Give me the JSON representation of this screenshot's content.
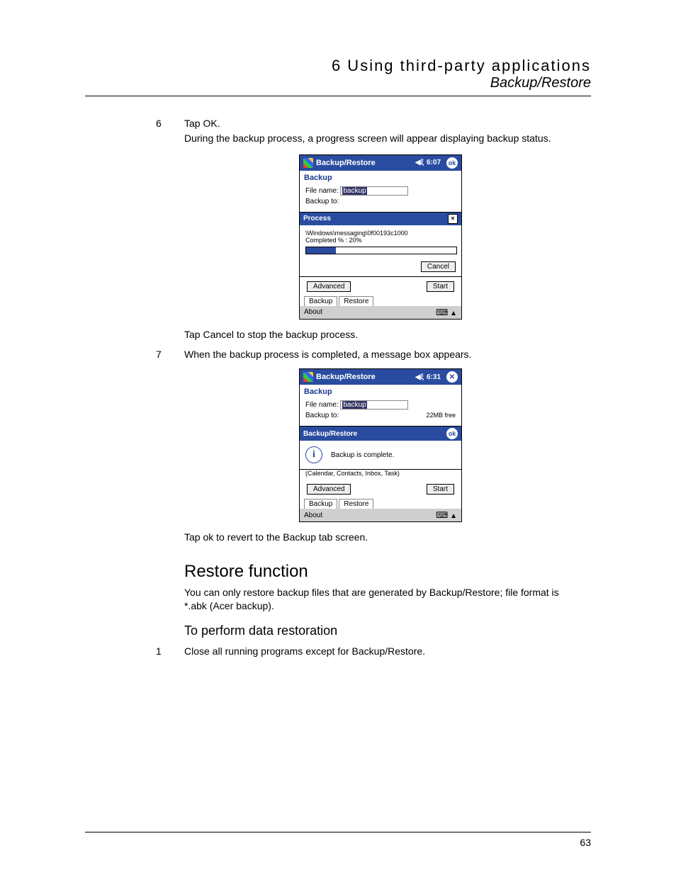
{
  "header": {
    "chapter": "6 Using third-party applications",
    "section": "Backup/Restore"
  },
  "steps": {
    "six": {
      "num": "6",
      "title": "Tap OK.",
      "desc": "During the backup process, a progress screen will appear displaying backup status."
    },
    "cancel_note": "Tap Cancel to stop the backup process.",
    "seven": {
      "num": "7",
      "title": "When the backup process is completed, a message box appears."
    },
    "ok_note": "Tap ok to revert to the Backup tab screen."
  },
  "shot1": {
    "title": "Backup/Restore",
    "time": "6:07",
    "ok": "ok",
    "subhead": "Backup",
    "filename_label": "File name:",
    "filename_value": "backup",
    "backupto_label": "Backup to:",
    "dialog_title": "Process",
    "close": "×",
    "path": "\\Windows\\messaging\\0f00193c1000",
    "completed": "Completed % : 20%",
    "cancel_btn": "Cancel",
    "advanced_btn": "Advanced",
    "start_btn": "Start",
    "tab_backup": "Backup",
    "tab_restore": "Restore",
    "menubar": "About",
    "arrow": "▲"
  },
  "shot2": {
    "title": "Backup/Restore",
    "time": "6:31",
    "close_x": "✕",
    "subhead": "Backup",
    "filename_label": "File name:",
    "filename_value": "backup",
    "backupto_label": "Backup to:",
    "free_label": "22MB free",
    "dialog_title": "Backup/Restore",
    "ok": "ok",
    "msg": "Backup is complete.",
    "filters": "(Calendar, Contacts, Inbox, Task)",
    "advanced_btn": "Advanced",
    "start_btn": "Start",
    "tab_backup": "Backup",
    "tab_restore": "Restore",
    "menubar": "About",
    "arrow": "▲"
  },
  "restore": {
    "heading": "Restore function",
    "para": "You can only restore backup files that are generated by Backup/Restore; file format is *.abk (Acer backup).",
    "subheading": "To perform data restoration",
    "step1_num": "1",
    "step1_text": "Close all running programs except for Backup/Restore."
  },
  "page_number": "63"
}
